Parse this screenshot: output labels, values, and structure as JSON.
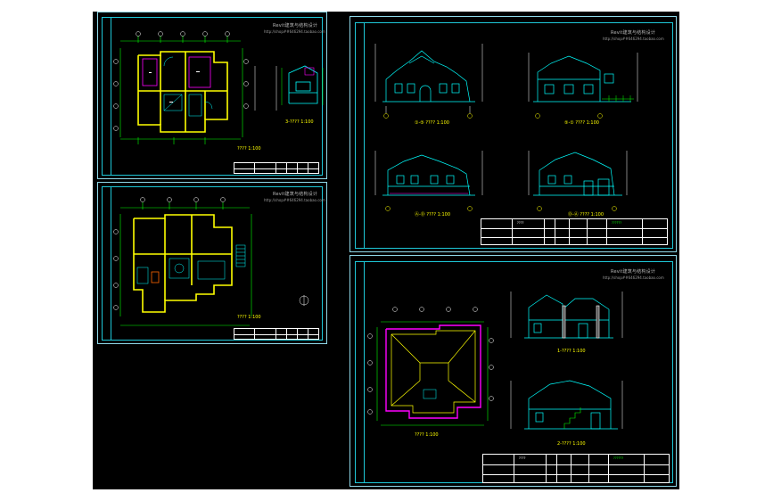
{
  "watermark": {
    "line1": "Revit建筑与结构设计",
    "line2": "http://shop##646294.taobao.com"
  },
  "sheets": {
    "floor2": {
      "plan_caption": "????  1:100",
      "section_caption": "3-???? 1:100"
    },
    "floor1": {
      "plan_caption": "????  1:100"
    },
    "elevations": {
      "captions": [
        "①-⑤ ???? 1:100",
        "⑤-① ???? 1:100",
        "Ⓐ-Ⓓ ???? 1:100",
        "Ⓓ-Ⓐ ???? 1:100"
      ]
    },
    "roof_sections": {
      "roof_caption": "????  1:100",
      "section_captions": [
        "1-???? 1:100",
        "2-???? 1:100"
      ]
    }
  },
  "title_block": {
    "drawing_label": "????",
    "project_label": "??????"
  },
  "colors": {
    "background": "#000000",
    "frame": "#1ec8d8",
    "walls": "#ffff00",
    "dimensions": "#00ff00",
    "roof_outline": "#ff00ff",
    "axis": "#ffffff"
  }
}
